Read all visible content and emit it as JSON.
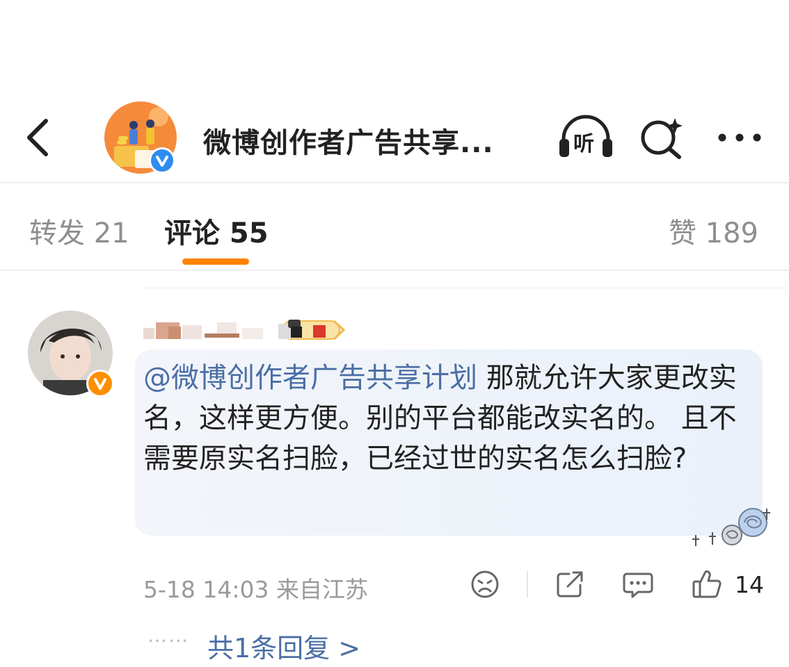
{
  "header": {
    "back_icon": "chevron-left-icon",
    "title": "微博创作者广告共享...",
    "listen_label": "听",
    "search_icon": "search-sparkle-icon",
    "more_icon": "more-dots-icon"
  },
  "tabs": {
    "repost_label": "转发 21",
    "comment_label": "评论 55",
    "like_label": "赞 189",
    "active_color": "#ff8200"
  },
  "comment": {
    "mention": "@微博创作者广告共享计划",
    "body": " 那就允许大家更改实名，这样更方便。别的平台都能改实名的。 且不需要原实名扫脸，已经过世的实名怎么扫脸?",
    "timestamp": "5-18 14:03",
    "location": "来自江苏",
    "like_count": "14",
    "reply_dots": "……",
    "reply_link": "共1条回复 >",
    "mention_color": "#4a6fa5"
  }
}
